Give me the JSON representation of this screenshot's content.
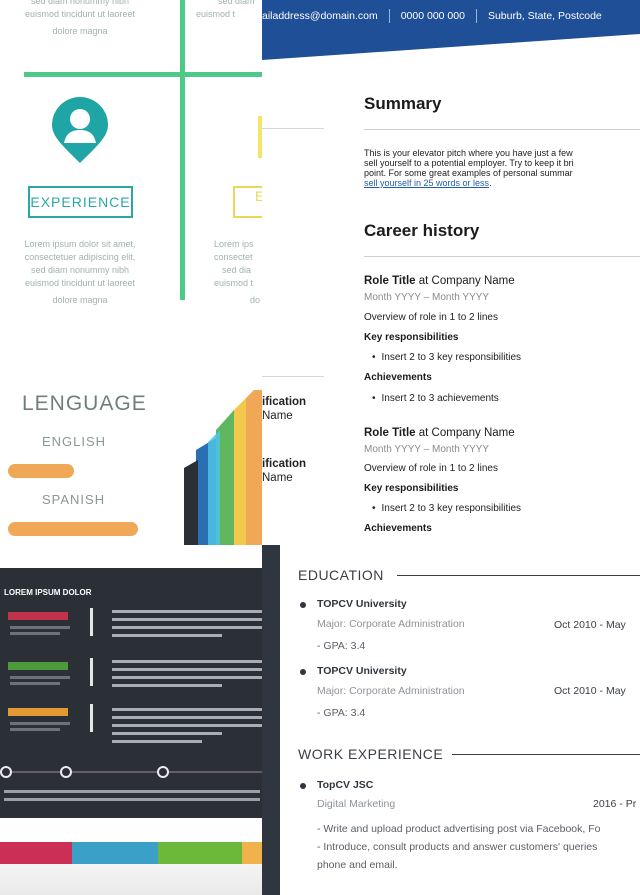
{
  "infographic": {
    "lorem_short": "sed diam nonummy nibh",
    "lorem_tail_1": "euismod tincidunt ut laoreet",
    "lorem_tail_2": "dolore magna",
    "lorem_mid_1": "sed diam",
    "lorem_mid_2": "euismod t",
    "lorem_b1": "Lorem ipsum dolor sit amet,",
    "lorem_b2": "consectetuer adipiscing elit,",
    "lorem_b3": "sed diam nonummy nibh",
    "lorem_b4": "euismod tincidunt ut laoreet",
    "lorem_b5": "dolore magna",
    "lorem_c1": "Lorem ips",
    "lorem_c2": "consectet",
    "lorem_c3": "sed dia",
    "lorem_c4": "euismod t",
    "lorem_c5": "do",
    "experience_label": "EXPERIENCE",
    "experience_label_2": "E",
    "language_title": "LENGUAGE",
    "language_1": "ENGLISH",
    "language_1_level": 0.45,
    "language_2": "SPANISH",
    "language_2_level": 0.9,
    "colors": {
      "accent_green": "#4ec98a",
      "teal": "#2aa7a7",
      "orange": "#f0a857"
    }
  },
  "resume": {
    "contact": {
      "email": "ailaddress@domain.com",
      "phone": "0000 000 000",
      "address": "Suburb, State, Postcode"
    },
    "sidebar": {
      "q1_title": "ification",
      "q1_sub": "Name",
      "q2_title": "ification",
      "q2_sub": "Name"
    },
    "summary_heading": "Summary",
    "summary_line_1": "This is your elevator pitch where you have just a few",
    "summary_line_2": "sell yourself to a potential employer. Try to keep it bri",
    "summary_line_3": "point. For some great examples of personal summar",
    "summary_link": "sell yourself in 25 words or less",
    "summary_link_end": ".",
    "career_heading": "Career history",
    "roles": [
      {
        "title": "Role Title",
        "connector": "at Company Name",
        "dates": "Month YYYY – Month YYYY",
        "overview": "Overview of role in 1 to 2 lines",
        "resp_heading": "Key responsibilities",
        "resp_item": "Insert 2 to 3 key responsibilities",
        "ach_heading": "Achievements",
        "ach_item": "Insert 2 to 3 achievements"
      },
      {
        "title": "Role Title",
        "connector": "at Company Name",
        "dates": "Month YYYY – Month YYYY",
        "overview": "Overview of role in 1 to 2 lines",
        "resp_heading": "Key responsibilities",
        "resp_item": "Insert 2 to 3 key responsibilities",
        "ach_heading": "Achievements"
      }
    ],
    "colors": {
      "band": "#1f4f96",
      "link": "#1f5fae"
    }
  },
  "dark_infographic": {
    "title": "LOREM IPSUM DOLOR",
    "colors": {
      "bg": "#2b2f36",
      "red": "#c0334a",
      "green": "#4c9a3c",
      "orange": "#e39a33",
      "stripe_1": "#cc2f55",
      "stripe_2": "#3aa0c8",
      "stripe_3": "#6cb83a",
      "stripe_4": "#f0b24a"
    }
  },
  "topcv": {
    "education_heading": "EDUCATION",
    "education": [
      {
        "school": "TOPCV University",
        "major": "Major: Corporate Administration",
        "dates": "Oct 2010  -  May",
        "gpa": "- GPA: 3.4"
      },
      {
        "school": "TOPCV University",
        "major": "Major: Corporate Administration",
        "dates": "Oct 2010  -  May",
        "gpa": "- GPA: 3.4"
      }
    ],
    "work_heading": "WORK EXPERIENCE",
    "work": [
      {
        "company": "TopCV JSC",
        "position": "Digital Marketing",
        "dates": "2016 - Pr",
        "line_1": "- Write and upload product advertising post via Facebook, Fo",
        "line_2": "- Introduce, consult products and answer customers' queries",
        "line_3": "phone and email."
      }
    ]
  }
}
